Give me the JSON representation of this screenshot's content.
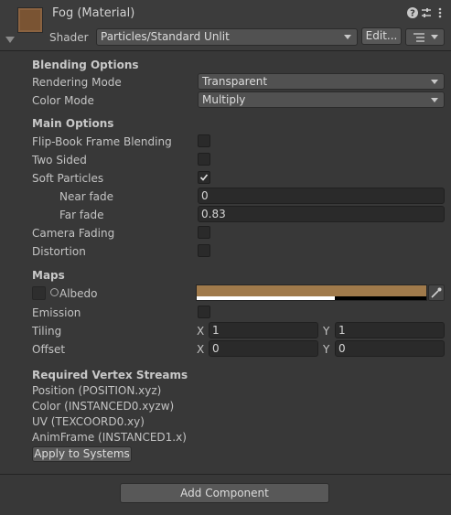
{
  "header": {
    "title": "Fog (Material)",
    "shader_label": "Shader",
    "shader_value": "Particles/Standard Unlit",
    "edit_button": "Edit...",
    "help_icon": "?",
    "settings_icon": "⇄",
    "menu_icon": "⋮"
  },
  "sections": {
    "blending": "Blending Options",
    "main": "Main Options",
    "maps": "Maps",
    "streams": "Required Vertex Streams"
  },
  "blending": {
    "rendering_mode_label": "Rendering Mode",
    "rendering_mode_value": "Transparent",
    "color_mode_label": "Color Mode",
    "color_mode_value": "Multiply"
  },
  "main": {
    "flipbook_label": "Flip-Book Frame Blending",
    "two_sided_label": "Two Sided",
    "soft_particles_label": "Soft Particles",
    "near_fade_label": "Near fade",
    "near_fade_value": "0",
    "far_fade_label": "Far fade",
    "far_fade_value": "0.83",
    "camera_fading_label": "Camera Fading",
    "distortion_label": "Distortion",
    "soft_particles_checked": true,
    "flipbook_checked": false,
    "two_sided_checked": false,
    "camera_fading_checked": false,
    "distortion_checked": false
  },
  "maps": {
    "albedo_label": "Albedo",
    "albedo_color": "#a07a4b",
    "albedo_alpha_fraction": 0.6,
    "emission_label": "Emission",
    "tiling_label": "Tiling",
    "tiling_x": "1",
    "tiling_y": "1",
    "offset_label": "Offset",
    "offset_x": "0",
    "offset_y": "0",
    "x_label": "X",
    "y_label": "Y"
  },
  "streams": {
    "items": [
      "Position (POSITION.xyz)",
      "Color (INSTANCED0.xyzw)",
      "UV (TEXCOORD0.xy)",
      "AnimFrame (INSTANCED1.x)"
    ],
    "apply_button": "Apply to Systems"
  },
  "footer": {
    "add_component": "Add Component"
  },
  "colors": {
    "background": "#383838",
    "header": "#3c3c3c",
    "field": "#2a2a2a",
    "material_thumb": "#7a5433"
  }
}
